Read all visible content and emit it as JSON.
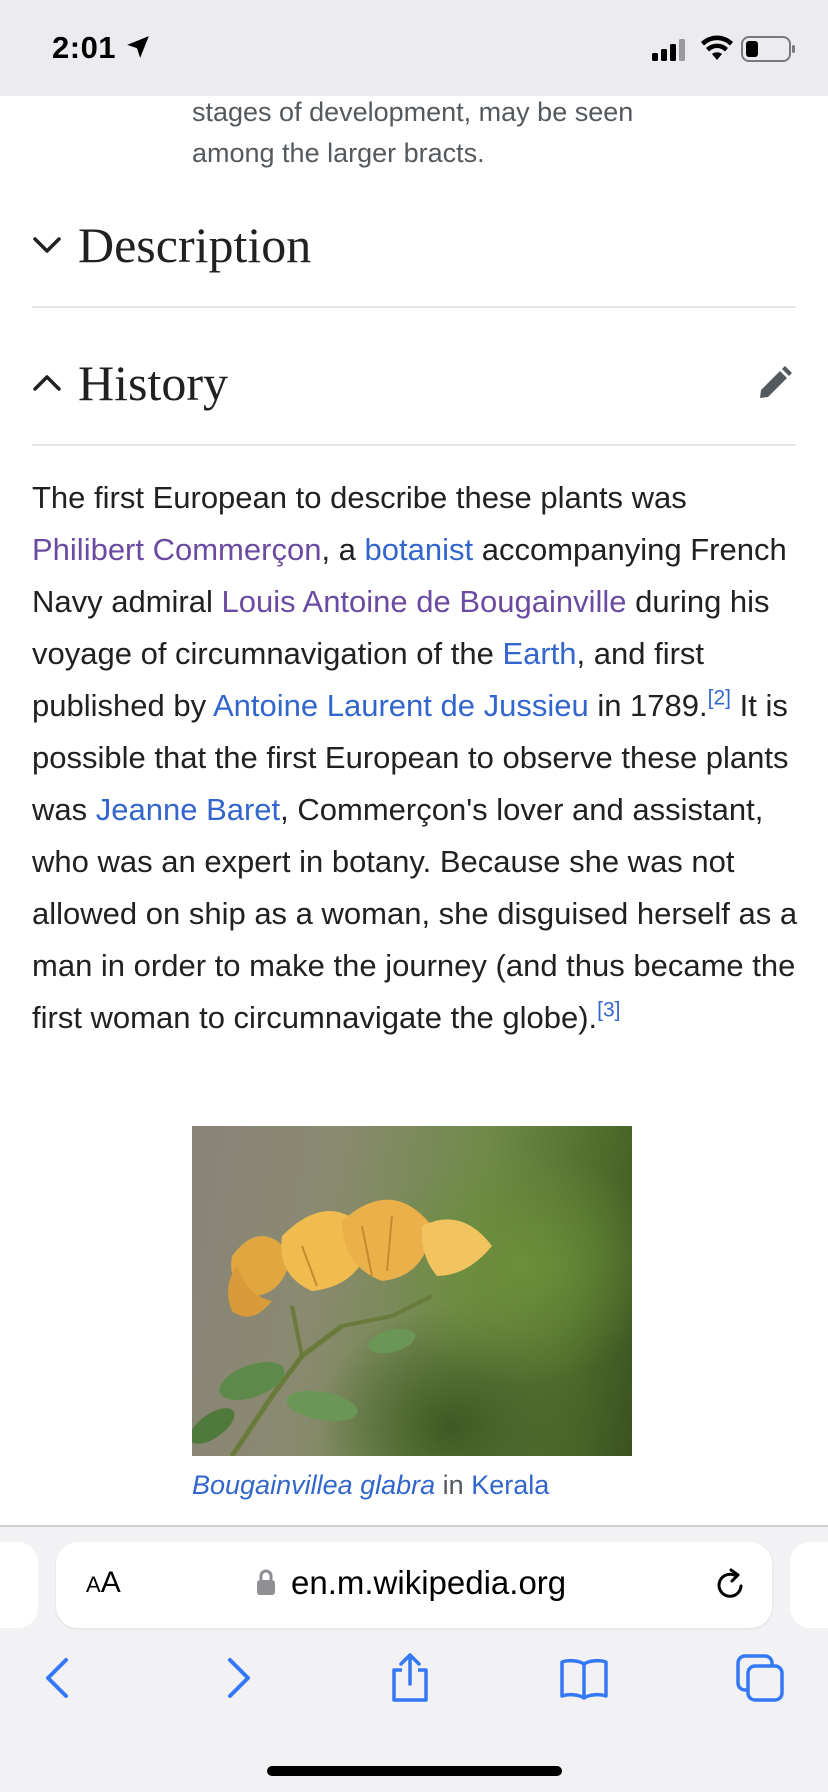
{
  "status_bar": {
    "time": "2:01"
  },
  "figure_caption_top": "stages of development, may be seen among the larger bracts.",
  "sections": {
    "description": {
      "title": "Description"
    },
    "history": {
      "title": "History"
    }
  },
  "paragraph": {
    "t1": "The first European to describe these plants was ",
    "l1": "Philibert Commerçon",
    "t2": ", a ",
    "l2": "botanist",
    "t3": " accompanying French Navy admiral ",
    "l3": "Louis Antoine de Bougainville",
    "t4": " during his voyage of circumnavigation of the ",
    "l4": "Earth",
    "t5": ", and first published by ",
    "l5": "Antoine Laurent de Jussieu",
    "t6": " in 1789.",
    "ref1": "[2]",
    "t7": " It is possible that the first European to observe these plants was ",
    "l6": "Jeanne Baret",
    "t8": ", Commerçon's lover and assistant, who was an expert in botany. Because she was not allowed on ship as a woman, she disguised herself as a man in order to make the journey (and thus became the first woman to circumnavigate the globe).",
    "ref2": "[3]"
  },
  "figure": {
    "caption_species": "Bougainvillea glabra",
    "caption_in": " in ",
    "caption_place": "Kerala"
  },
  "safari": {
    "aa_large": "A",
    "aa_small": "A",
    "url": "en.m.wikipedia.org"
  },
  "icons": {
    "back": "chevron-left-icon",
    "forward": "chevron-right-icon",
    "share": "share-icon",
    "bookmarks": "book-icon",
    "tabs": "tabs-icon"
  },
  "colors": {
    "link": "#3366cc",
    "visited_link": "#6b4ba1",
    "safari_blue": "#3478f6"
  }
}
